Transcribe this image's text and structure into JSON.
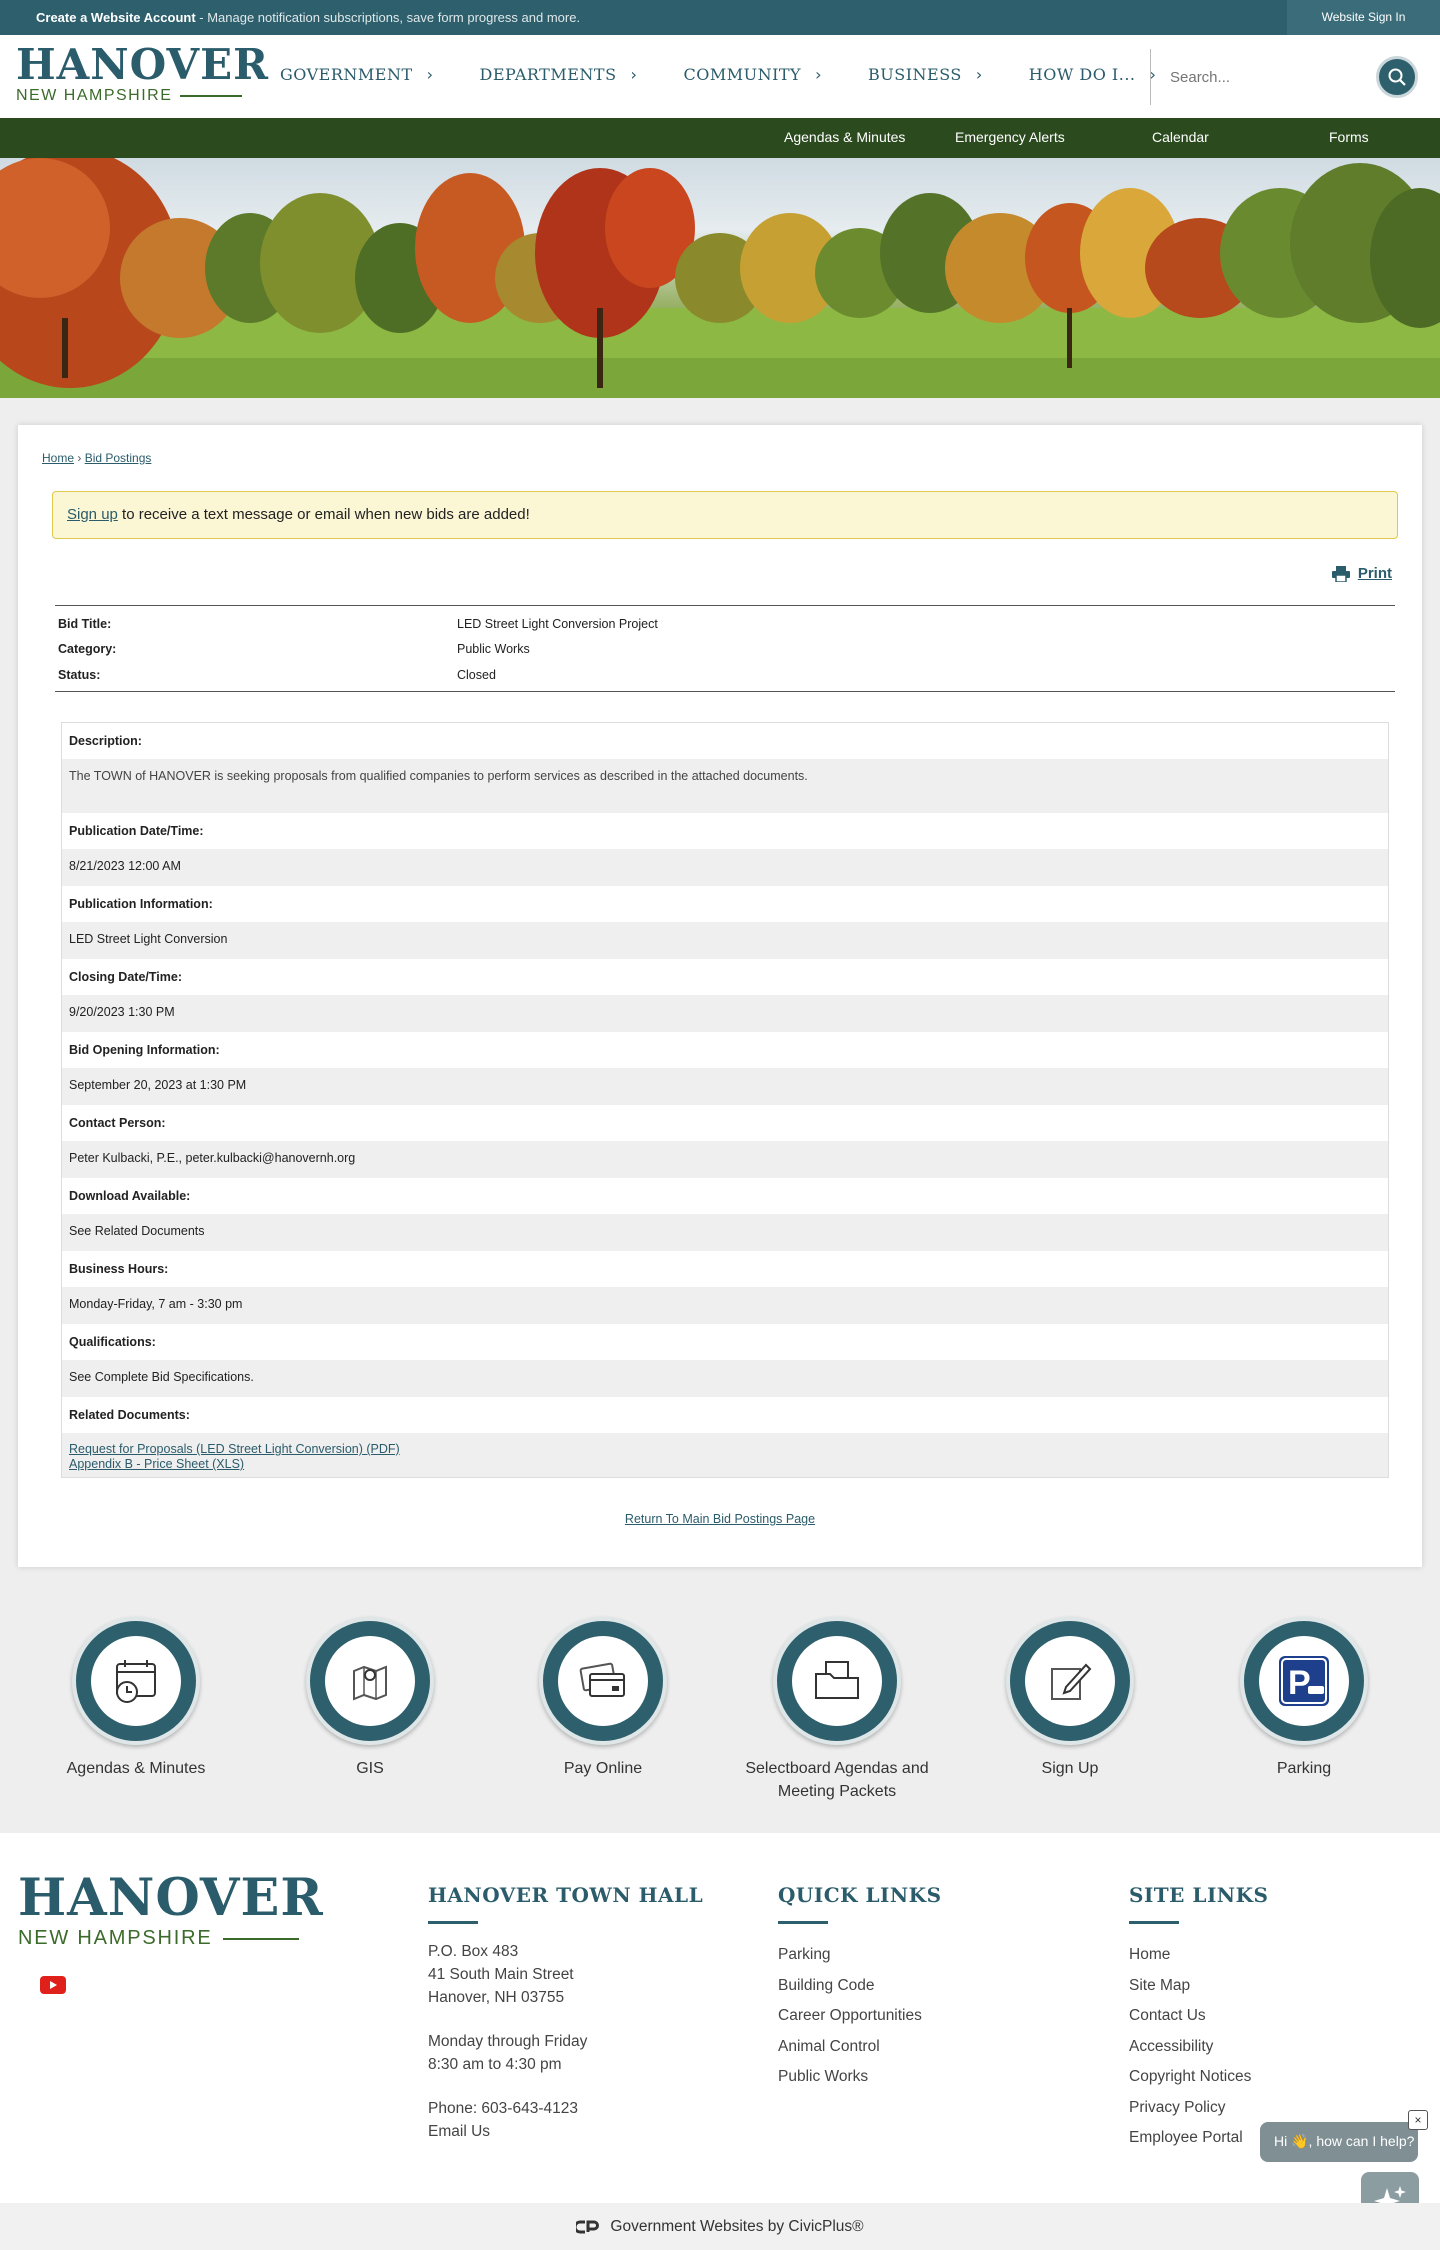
{
  "topbar": {
    "create_account": "Create a Website Account",
    "create_account_desc": " - Manage notification subscriptions, save form progress and more.",
    "sign_in": "Website Sign In"
  },
  "logo": {
    "name": "HANOVER",
    "state": "NEW HAMPSHIRE"
  },
  "nav": [
    "GOVERNMENT",
    "DEPARTMENTS",
    "COMMUNITY",
    "BUSINESS",
    "HOW DO I..."
  ],
  "search": {
    "placeholder": "Search..."
  },
  "subnav": [
    "Agendas & Minutes",
    "Emergency Alerts",
    "Calendar",
    "Forms"
  ],
  "breadcrumb": {
    "home": "Home",
    "sep": " › ",
    "current": "Bid Postings"
  },
  "alert": {
    "link": "Sign up",
    "text": " to receive a text message or email when new bids are added!"
  },
  "print_label": "Print",
  "bid": {
    "title_label": "Bid Title:",
    "title": "LED Street Light Conversion Project",
    "category_label": "Category:",
    "category": "Public Works",
    "status_label": "Status:",
    "status": "Closed"
  },
  "details": {
    "description_label": "Description:",
    "description": "The TOWN of HANOVER is seeking proposals from qualified companies to perform services as described in the attached documents.",
    "pub_date_label": "Publication Date/Time:",
    "pub_date": "8/21/2023 12:00 AM",
    "pub_info_label": "Publication Information:",
    "pub_info": "LED Street Light Conversion",
    "closing_label": "Closing Date/Time:",
    "closing": "9/20/2023 1:30 PM",
    "opening_label": "Bid Opening Information:",
    "opening": "September 20, 2023 at 1:30 PM",
    "contact_label": "Contact Person:",
    "contact": "Peter Kulbacki, P.E., peter.kulbacki@hanovernh.org",
    "download_label": "Download Available:",
    "download": "See Related Documents",
    "hours_label": "Business Hours:",
    "hours": "Monday-Friday, 7 am - 3:30 pm",
    "qual_label": "Qualifications:",
    "qual": "See Complete Bid Specifications.",
    "docs_label": "Related Documents:",
    "docs": [
      "Request for Proposals (LED Street Light Conversion) (PDF)",
      "Appendix B - Price Sheet (XLS)"
    ]
  },
  "return_link": "Return To Main Bid Postings Page",
  "quick_icons": [
    {
      "label": "Agendas & Minutes",
      "icon": "calendar-clock-icon"
    },
    {
      "label": "GIS",
      "icon": "map-pin-icon"
    },
    {
      "label": "Pay Online",
      "icon": "credit-card-icon"
    },
    {
      "label": "Selectboard Agendas and Meeting Packets",
      "icon": "folder-icon"
    },
    {
      "label": "Sign Up",
      "icon": "pencil-note-icon"
    },
    {
      "label": "Parking",
      "icon": "parking-icon"
    }
  ],
  "footer": {
    "town_hall": {
      "title": "HANOVER TOWN HALL",
      "lines": [
        "P.O. Box 483",
        "41 South Main Street",
        "Hanover, NH 03755"
      ],
      "hours": [
        "Monday through Friday",
        "8:30 am to 4:30 pm"
      ],
      "phone": "Phone: 603-643-4123",
      "email": "Email Us"
    },
    "quick_links": {
      "title": "QUICK LINKS",
      "items": [
        "Parking",
        "Building Code",
        "Career Opportunities",
        "Animal Control",
        "Public Works"
      ]
    },
    "site_links": {
      "title": "SITE LINKS",
      "items": [
        "Home",
        "Site Map",
        "Contact Us",
        "Accessibility",
        "Copyright Notices",
        "Privacy Policy",
        "Employee Portal"
      ]
    }
  },
  "chat": {
    "text": "Hi 👋, how can I help?",
    "close": "×"
  },
  "bottom": "Government Websites by CivicPlus®",
  "colors": {
    "primary": "#2e5f6c",
    "green": "#2b4a1e",
    "accent_green": "#3b6b2a"
  }
}
